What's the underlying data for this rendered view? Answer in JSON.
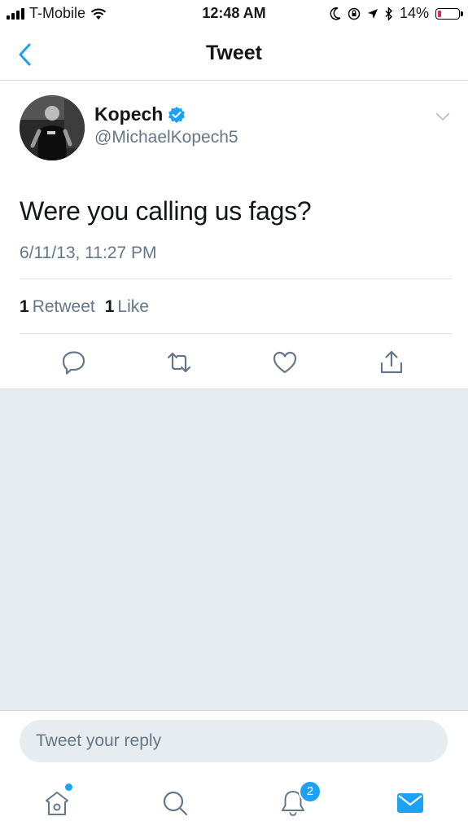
{
  "status_bar": {
    "carrier": "T-Mobile",
    "time": "12:48 AM",
    "battery_percent": "14%",
    "battery_level": 0.14,
    "icons": [
      "signal-icon",
      "wifi-icon",
      "moon-icon",
      "orientation-lock-icon",
      "location-icon",
      "bluetooth-icon",
      "battery-icon"
    ]
  },
  "nav": {
    "title": "Tweet",
    "back_icon": "back-chevron-icon"
  },
  "tweet": {
    "display_name": "Kopech",
    "handle": "@MichaelKopech5",
    "verified": true,
    "text": "Were you calling us fags?",
    "timestamp": "6/11/13, 11:27 PM",
    "retweet_count": "1",
    "retweet_label": "Retweet",
    "like_count": "1",
    "like_label": "Like"
  },
  "actions": [
    "reply-icon",
    "retweet-icon",
    "like-icon",
    "share-icon"
  ],
  "reply_box": {
    "placeholder": "Tweet your reply"
  },
  "tab_bar": {
    "tabs": [
      "home-icon",
      "search-icon",
      "notifications-icon",
      "messages-icon"
    ],
    "notifications_badge": "2"
  },
  "colors": {
    "accent": "#1da1f2",
    "text_secondary": "#657786",
    "background_gray": "#e6ecf0",
    "battery_low": "#e0245e"
  }
}
